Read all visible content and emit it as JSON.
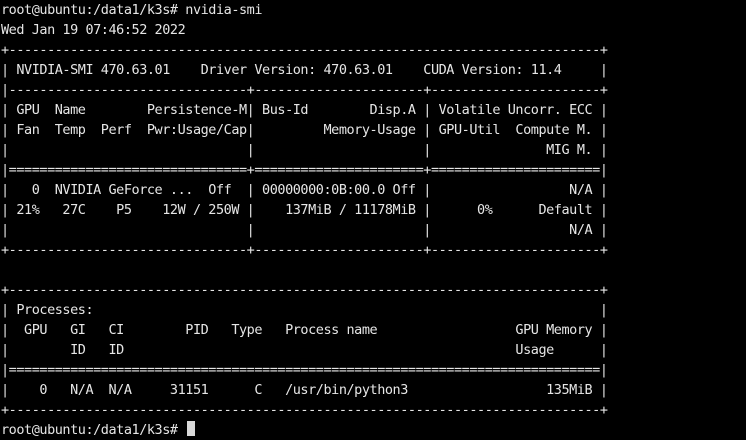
{
  "terminal": {
    "lines": [
      "root@ubuntu:/data1/k3s# nvidia-smi",
      "Wed Jan 19 07:46:52 2022",
      "+-----------------------------------------------------------------------------+",
      "| NVIDIA-SMI 470.63.01    Driver Version: 470.63.01    CUDA Version: 11.4     |",
      "|-------------------------------+----------------------+----------------------+",
      "| GPU  Name        Persistence-M| Bus-Id        Disp.A | Volatile Uncorr. ECC |",
      "| Fan  Temp  Perf  Pwr:Usage/Cap|         Memory-Usage | GPU-Util  Compute M. |",
      "|                               |                      |               MIG M. |",
      "|===============================+======================+======================|",
      "|   0  NVIDIA GeForce ...  Off  | 00000000:0B:00.0 Off |                  N/A |",
      "| 21%   27C    P5    12W / 250W |    137MiB / 11178MiB |      0%      Default |",
      "|                               |                      |                  N/A |",
      "+-------------------------------+----------------------+----------------------+",
      "",
      "+-----------------------------------------------------------------------------+",
      "| Processes:                                                                  |",
      "|  GPU   GI   CI        PID   Type   Process name                  GPU Memory |",
      "|        ID   ID                                                   Usage      |",
      "|=============================================================================|",
      "|    0   N/A  N/A     31151      C   /usr/bin/python3                  135MiB |",
      "+-----------------------------------------------------------------------------+"
    ],
    "prompt": "root@ubuntu:/data1/k3s# "
  }
}
